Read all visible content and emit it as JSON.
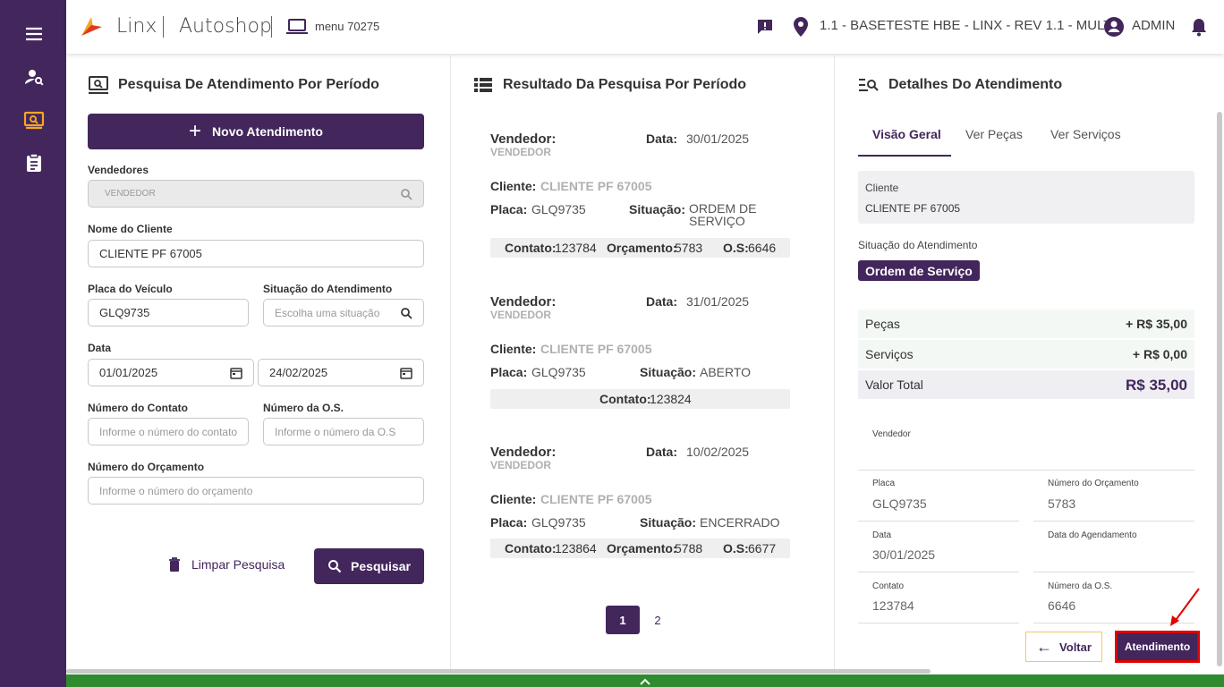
{
  "topbar": {
    "brand_linx": "Linx",
    "brand_autoshop": "Autoshop",
    "menu": "menu 70275",
    "store": "1.1 - BASETESTE HBE - LINX - REV 1.1 - MULT",
    "user": "ADMIN"
  },
  "search": {
    "title": "Pesquisa De Atendimento Por Período",
    "new_button": "Novo Atendimento",
    "vendedores_label": "Vendedores",
    "vendedores_value": "VENDEDOR",
    "cliente_label": "Nome do Cliente",
    "cliente_value": "CLIENTE PF 67005",
    "placa_label": "Placa do Veículo",
    "placa_value": "GLQ9735",
    "situacao_label": "Situação do Atendimento",
    "situacao_placeholder": "Escolha uma situação",
    "data_label": "Data",
    "data_inicio": "01/01/2025",
    "data_fim": "24/02/2025",
    "contato_label": "Número do Contato",
    "contato_placeholder": "Informe o número do contato",
    "os_label": "Número da O.S.",
    "os_placeholder": "Informe o número da O.S",
    "orcamento_label": "Número do Orçamento",
    "orcamento_placeholder": "Informe o número do orçamento",
    "clear_button": "Limpar Pesquisa",
    "search_button": "Pesquisar"
  },
  "results": {
    "title": "Resultado Da Pesquisa Por Período",
    "lbl_vendedor": "Vendedor:",
    "lbl_data": "Data:",
    "lbl_cliente": "Cliente:",
    "lbl_placa": "Placa:",
    "lbl_situacao": "Situação:",
    "lbl_contato": "Contato:",
    "lbl_orcamento": "Orçamento:",
    "lbl_os": "O.S:",
    "items": [
      {
        "vendedor": "VENDEDOR",
        "data": "30/01/2025",
        "cliente": "CLIENTE PF 67005",
        "placa": "GLQ9735",
        "situacao": "ORDEM DE SERVIÇO",
        "contato": "123784",
        "orcamento": "5783",
        "os": "6646"
      },
      {
        "vendedor": "VENDEDOR",
        "data": "31/01/2025",
        "cliente": "CLIENTE PF 67005",
        "placa": "GLQ9735",
        "situacao": "ABERTO",
        "contato": "123824"
      },
      {
        "vendedor": "VENDEDOR",
        "data": "10/02/2025",
        "cliente": "CLIENTE PF 67005",
        "placa": "GLQ9735",
        "situacao": "ENCERRADO",
        "contato": "123864",
        "orcamento": "5788",
        "os": "6677"
      }
    ],
    "pages": [
      "1",
      "2"
    ]
  },
  "details": {
    "title": "Detalhes Do Atendimento",
    "tabs": [
      "Visão Geral",
      "Ver Peças",
      "Ver Serviços"
    ],
    "cliente_label": "Cliente",
    "cliente_value": "CLIENTE PF 67005",
    "situacao_label": "Situação do Atendimento",
    "situacao_badge": "Ordem de Serviço",
    "pecas_label": "Peças",
    "pecas_value": "+ R$ 35,00",
    "servicos_label": "Serviços",
    "servicos_value": "+ R$ 0,00",
    "total_label": "Valor Total",
    "total_value": "R$ 35,00",
    "vendedor_label": "Vendedor",
    "placa_label": "Placa",
    "placa_value": "GLQ9735",
    "num_orcamento_label": "Número do Orçamento",
    "num_orcamento_value": "5783",
    "data_label": "Data",
    "data_value": "30/01/2025",
    "data_agendamento_label": "Data do Agendamento",
    "contato_label": "Contato",
    "contato_value": "123784",
    "num_os_label": "Número da O.S.",
    "num_os_value": "6646",
    "back_button": "Voltar",
    "atendimento_button": "Atendimento"
  },
  "colors": {
    "primary": "#42265c",
    "accent": "#f5a623",
    "footer": "#2e8b2e",
    "highlight": "#e00000"
  }
}
